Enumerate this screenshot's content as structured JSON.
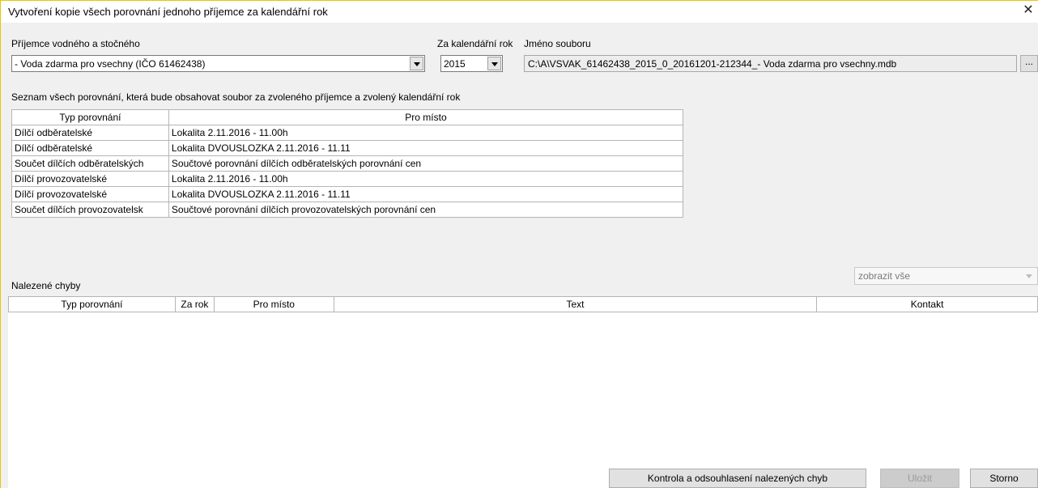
{
  "window": {
    "title": "Vytvoření kopie všech porovnání jednoho příjemce za kalendářní rok",
    "close_glyph": "✕"
  },
  "recipient": {
    "label": "Příjemce vodného a stočného",
    "value": "- Voda zdarma pro vsechny (IČO 61462438)"
  },
  "year": {
    "label": "Za kalendářní rok",
    "value": "2015"
  },
  "filename": {
    "label": "Jméno souboru",
    "value": "C:\\A\\VSVAK_61462438_2015_0_20161201-212344_- Voda zdarma pro vsechny.mdb",
    "browse_label": "..."
  },
  "comparisons": {
    "caption": "Seznam všech porovnání, která bude obsahovat soubor za zvoleného příjemce a zvolený kalendářní rok",
    "headers": [
      "Typ porovnání",
      "Pro místo"
    ],
    "rows": [
      [
        "Dílčí odběratelské",
        "Lokalita 2.11.2016 - 11.00h"
      ],
      [
        "Dílčí odběratelské",
        "Lokalita DVOUSLOZKA 2.11.2016 - 11.11"
      ],
      [
        "Součet dílčích odběratelských",
        "Součtové porovnání dílčích odběratelských porovnání cen"
      ],
      [
        "Dílčí provozovatelské",
        "Lokalita 2.11.2016 - 11.00h"
      ],
      [
        "Dílčí provozovatelské",
        "Lokalita DVOUSLOZKA 2.11.2016 - 11.11"
      ],
      [
        "Součet dílčích provozovatelsk",
        "Součtové porovnání dílčích provozovatelských porovnání cen"
      ]
    ]
  },
  "errors": {
    "caption": "Nalezené chyby",
    "filter_value": "zobrazit vše",
    "headers": [
      "Typ porovnání",
      "Za rok",
      "Pro místo",
      "Text",
      "Kontakt"
    ]
  },
  "buttons": {
    "check": "Kontrola a odsouhlasení nalezených chyb",
    "save": "Uložit",
    "cancel": "Storno"
  }
}
